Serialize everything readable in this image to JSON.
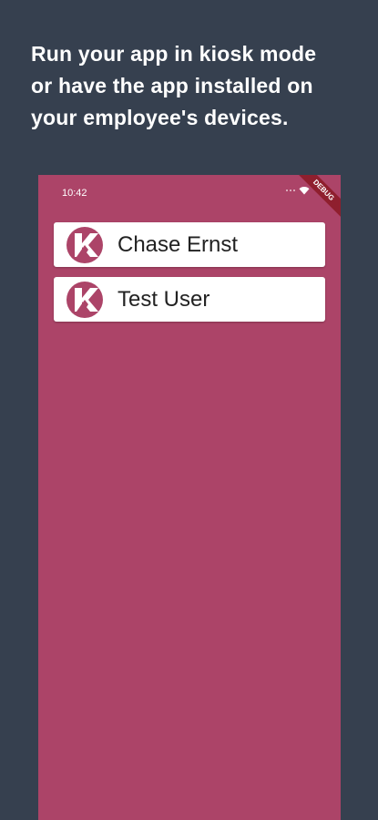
{
  "headline": {
    "lines": [
      "Run your app in kiosk mode",
      "or have the app installed on",
      "your employee's devices."
    ]
  },
  "status_bar": {
    "time": "10:42"
  },
  "debug_banner": "DEBUG",
  "colors": {
    "background": "#36404f",
    "app_background": "#ac4468",
    "avatar": "#ac4468",
    "card": "#ffffff"
  },
  "users": [
    {
      "name": "Chase Ernst",
      "icon": "k-logo-icon"
    },
    {
      "name": "Test User",
      "icon": "k-logo-icon"
    }
  ]
}
